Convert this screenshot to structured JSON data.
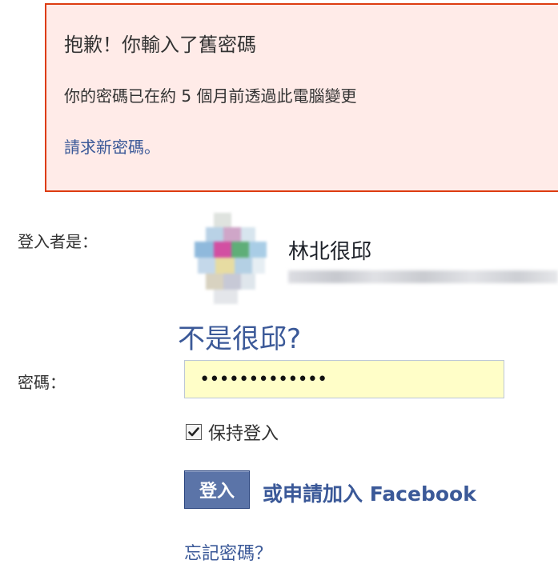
{
  "error": {
    "title": "抱歉！你輸入了舊密碼",
    "message": "你的密碼已在約 5 個月前透過此電腦變更",
    "link": "請求新密碼。"
  },
  "login": {
    "logged_in_label": "登入者是：",
    "account_name": "林北很邱",
    "not_you_link": "不是很邱?",
    "password_label": "密碼：",
    "password_value": "•••••••••••••",
    "remember_label": "保持登入",
    "remember_checked": true,
    "login_button": "登入",
    "signup_link": "或申請加入 Facebook",
    "forgot_link": "忘記密碼？"
  },
  "colors": {
    "error_bg": "#ffebe8",
    "error_border": "#dd3c10",
    "link": "#3b5998",
    "button_bg": "#5b74a8",
    "input_bg": "#fffec8"
  },
  "icons": {
    "checkbox": "checkmark-icon",
    "avatar": "blurred-profile-picture"
  }
}
